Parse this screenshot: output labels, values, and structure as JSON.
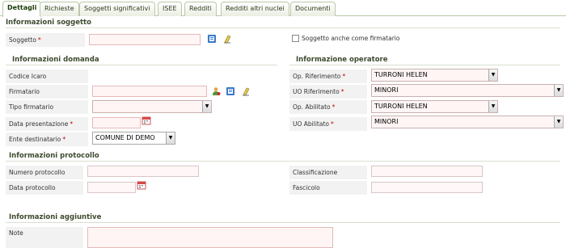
{
  "tabs": [
    "Dettagli",
    "Richieste",
    "Soggetti significativi",
    "ISEE",
    "Redditi",
    "Redditi altri nuclei",
    "Documenti"
  ],
  "sections": {
    "soggetto": "Informazioni soggetto",
    "domanda": "Informazioni domanda",
    "operatore": "Informazione operatore",
    "protocollo": "Informazioni protocollo",
    "aggiuntive": "Informazioni aggiuntive"
  },
  "required_mark": "*",
  "soggetto": {
    "label": "Soggetto",
    "value": "",
    "firmatario_checkbox_label": "Soggetto anche come firmatario",
    "firmatario_checked": false
  },
  "domanda": {
    "codice_icaro_label": "Codice Icaro",
    "codice_icaro_value": "",
    "firmatario_label": "Firmatario",
    "firmatario_value": "",
    "tipo_firmatario_label": "Tipo firmatario",
    "tipo_firmatario_value": "",
    "data_presentazione_label": "Data presentazione",
    "data_presentazione_value": "",
    "ente_destinatario_label": "Ente destinatario",
    "ente_destinatario_value": "COMUNE DI DEMO"
  },
  "operatore": {
    "op_riferimento_label": "Op. Riferimento",
    "op_riferimento_value": "TURRONI HELEN",
    "uo_riferimento_label": "UO Riferimento",
    "uo_riferimento_value": "MINORI",
    "op_abilitato_label": "Op. Abilitato",
    "op_abilitato_value": "TURRONI HELEN",
    "uo_abilitato_label": "UO Abilitato",
    "uo_abilitato_value": "MINORI"
  },
  "protocollo": {
    "numero_label": "Numero protocollo",
    "numero_value": "",
    "data_label": "Data protocollo",
    "data_value": "",
    "classificazione_label": "Classificazione",
    "classificazione_value": "",
    "fascicolo_label": "Fascicolo",
    "fascicolo_value": ""
  },
  "aggiuntive": {
    "note_label": "Note",
    "note_value": ""
  },
  "icons": {
    "search": "search-icon",
    "clear": "eraser-icon",
    "calendar": "calendar-icon",
    "person": "person-icon"
  },
  "colors": {
    "tab_border": "#b9c9a7",
    "required": "#cc0000",
    "input_bg": "#fff5f5",
    "input_border": "#e6b8b8",
    "label_bg": "#f2f2f2"
  }
}
